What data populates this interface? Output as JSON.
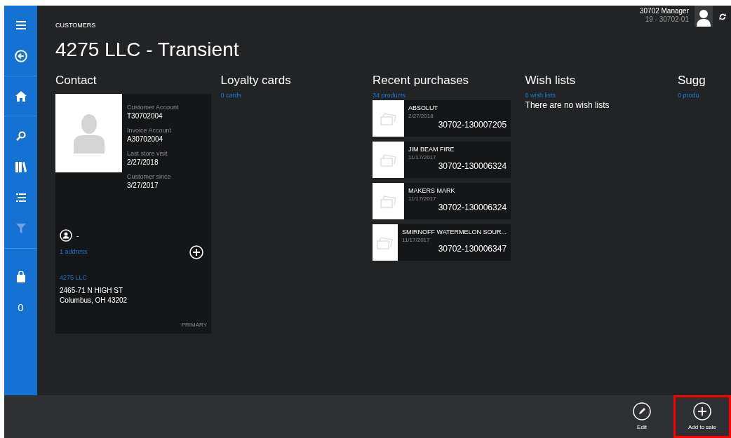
{
  "sidebar": {
    "groups": [
      [
        {
          "kind": "menu",
          "disabled": false
        },
        {
          "kind": "back",
          "disabled": false
        }
      ],
      [
        {
          "kind": "home",
          "disabled": false
        }
      ],
      [
        {
          "kind": "search",
          "disabled": false
        },
        {
          "kind": "books",
          "disabled": false
        },
        {
          "kind": "list",
          "disabled": false
        },
        {
          "kind": "filter",
          "disabled": true
        }
      ],
      [
        {
          "kind": "bag",
          "disabled": false
        },
        {
          "kind": "count",
          "text": "0",
          "disabled": false
        }
      ]
    ]
  },
  "user": {
    "name": "30702 Manager",
    "register": "19 - 30702-01"
  },
  "breadcrumb": "CUSTOMERS",
  "title": "4275 LLC - Transient",
  "contact": {
    "heading": "Contact",
    "fields": [
      {
        "label": "Customer Account",
        "value": "T30702004"
      },
      {
        "label": "Invoice Account",
        "value": "A30702004"
      },
      {
        "label": "Last store visit",
        "value": "2/27/2018"
      },
      {
        "label": "Customer since",
        "value": "3/27/2017"
      }
    ],
    "person": "-",
    "address_count": "1 address",
    "address": {
      "name": "4275 LLC",
      "lines": [
        "2465-71 N HIGH ST",
        "Columbus, OH 43202"
      ],
      "tag": "PRIMARY"
    }
  },
  "loyalty": {
    "heading": "Loyalty cards",
    "count": "0 cards"
  },
  "recent": {
    "heading": "Recent purchases",
    "count": "34 products",
    "items": [
      {
        "name": "ABSOLUT",
        "date": "2/27/2018",
        "number": "30702-130007205"
      },
      {
        "name": "JIM BEAM FIRE",
        "date": "11/17/2017",
        "number": "30702-130006324"
      },
      {
        "name": "MAKERS MARK",
        "date": "11/17/2017",
        "number": "30702-130006324"
      },
      {
        "name": "SMIRNOFF WATERMELON SOUR...",
        "date": "11/17/2017",
        "number": "30702-130006347"
      }
    ]
  },
  "wish": {
    "heading": "Wish lists",
    "count": "0 wish lists",
    "empty": "There are no wish lists"
  },
  "suggestions": {
    "heading": "Sugg",
    "count": "0 produ"
  },
  "app_bar": [
    {
      "kind": "edit",
      "label": "Edit",
      "highlighted": false
    },
    {
      "kind": "add",
      "label": "Add to sale",
      "highlighted": true
    }
  ]
}
